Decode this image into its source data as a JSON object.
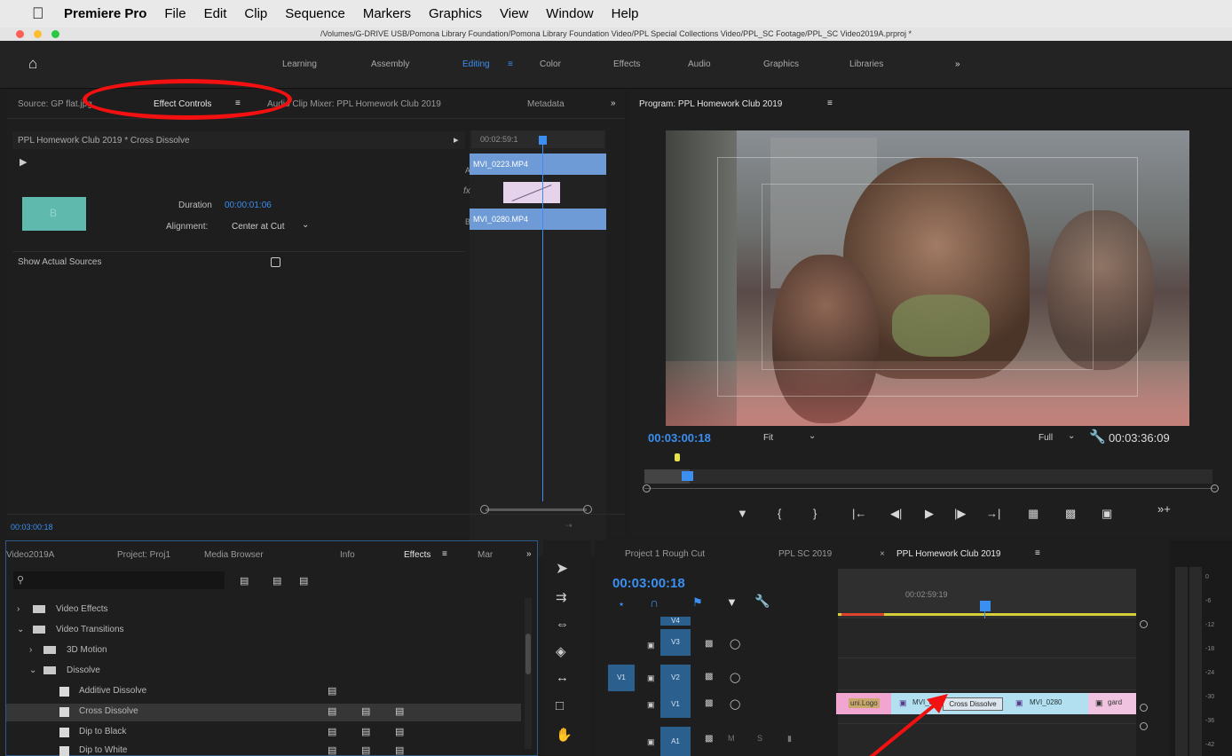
{
  "menubar": {
    "apple": "",
    "app": "Premiere Pro",
    "items": [
      "File",
      "Edit",
      "Clip",
      "Sequence",
      "Markers",
      "Graphics",
      "View",
      "Window",
      "Help"
    ]
  },
  "window": {
    "path": "/Volumes/G-DRIVE USB/Pomona Library Foundation/Pomona Library Foundation Video/PPL Special Collections Video/PPL_SC Footage/PPL_SC Video2019A.prproj *"
  },
  "workspaces": {
    "items": [
      "Learning",
      "Assembly",
      "Editing",
      "Color",
      "Effects",
      "Audio",
      "Graphics",
      "Libraries"
    ],
    "active": "Editing",
    "more": "»"
  },
  "source_panel": {
    "tabs": [
      "Source: GP flat.jpg",
      "Effect Controls",
      "Audio Clip Mixer: PPL Homework Club 2019",
      "Metadata"
    ],
    "active": "Effect Controls",
    "more": "»",
    "header": "PPL Homework Club 2019 * Cross Dissolve",
    "duration_label": "Duration",
    "duration_value": "00:00:01:06",
    "alignment_label": "Alignment:",
    "alignment_value": "Center at Cut",
    "show_sources_label": "Show Actual Sources",
    "mini_timecode": "00:02:59:1",
    "clip_a": "MVI_0223.MP4",
    "clip_b": "MVI_0280.MP4",
    "a_label": "A",
    "b_label": "B",
    "fx_label": "fx",
    "timecode": "00:03:00:18"
  },
  "program": {
    "title": "Program: PPL Homework Club 2019",
    "timecode": "00:03:00:18",
    "fit": "Fit",
    "full": "Full",
    "duration": "00:03:36:09"
  },
  "project_panel": {
    "tabs": [
      "Video2019A",
      "Project: Proj1",
      "Media Browser",
      "Info",
      "Effects",
      "Mar"
    ],
    "active": "Effects",
    "more": "»",
    "tree": [
      {
        "label": "Video Effects"
      },
      {
        "label": "Video Transitions"
      },
      {
        "label": "3D Motion"
      },
      {
        "label": "Dissolve"
      },
      {
        "label": "Additive Dissolve"
      },
      {
        "label": "Cross Dissolve"
      },
      {
        "label": "Dip to Black"
      },
      {
        "label": "Dip to White"
      }
    ]
  },
  "timeline": {
    "tabs": [
      "Project 1 Rough Cut",
      "PPL SC 2019",
      "PPL Homework Club 2019"
    ],
    "active": "PPL Homework Club 2019",
    "timecode": "00:03:00:18",
    "ruler_time": "00:02:59:19",
    "tracks": [
      "V4",
      "V3",
      "V2",
      "V1",
      "A1"
    ],
    "v1_target": "V1",
    "clips": [
      "uni.Logo",
      "MVI_0",
      "MVI_0280",
      "gard"
    ],
    "tooltip": "Cross Dissolve"
  },
  "meter": {
    "ticks": [
      "0",
      "-6",
      "-12",
      "-18",
      "-24",
      "-30",
      "-36",
      "-42"
    ]
  },
  "colors": {
    "accent": "#3b8ff0",
    "annotation": "#f21010"
  }
}
